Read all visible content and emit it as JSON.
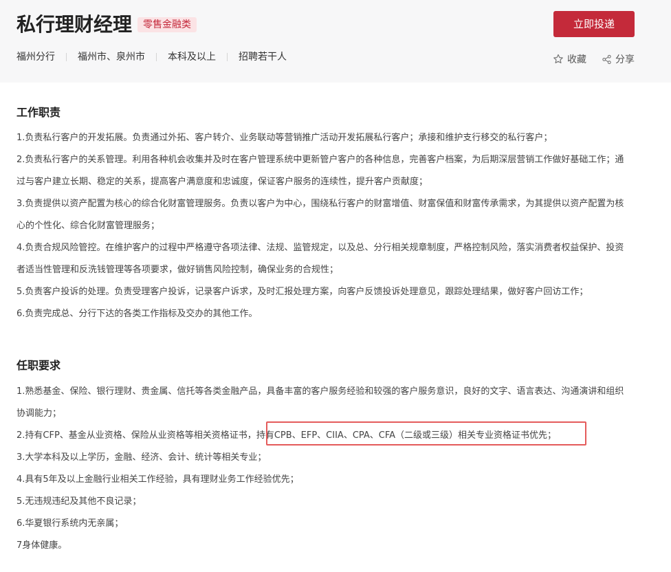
{
  "header": {
    "title": "私行理财经理",
    "category": "零售金融类",
    "meta": [
      "福州分行",
      "福州市、泉州市",
      "本科及以上",
      "招聘若干人"
    ],
    "apply_label": "立即投递",
    "favorite_label": "收藏",
    "share_label": "分享"
  },
  "colors": {
    "accent": "#c42a3a",
    "badge_bg": "#fbe3e5",
    "highlight": "#e45a5a"
  },
  "duties": {
    "title": "工作职责",
    "items": [
      "1.负责私行客户的开发拓展。负责通过外拓、客户转介、业务联动等营销推广活动开发拓展私行客户；承接和维护支行移交的私行客户；",
      "2.负责私行客户的关系管理。利用各种机会收集并及时在客户管理系统中更新管户客户的各种信息，完善客户档案，为后期深层营销工作做好基础工作；通过与客户建立长期、稳定的关系，提高客户满意度和忠诚度，保证客户服务的连续性，提升客户贡献度；",
      "3.负责提供以资产配置为核心的综合化财富管理服务。负责以客户为中心，围绕私行客户的财富增值、财富保值和财富传承需求，为其提供以资产配置为核心的个性化、综合化财富管理服务；",
      "4.负责合规风险管控。在维护客户的过程中严格遵守各项法律、法规、监管规定，以及总、分行相关规章制度，严格控制风险，落实消费者权益保护、投资者适当性管理和反洗钱管理等各项要求，做好销售风险控制，确保业务的合规性；",
      "5.负责客户投诉的处理。负责受理客户投诉，记录客户诉求，及时汇报处理方案，向客户反馈投诉处理意见，跟踪处理结果，做好客户回访工作；",
      "6.负责完成总、分行下达的各类工作指标及交办的其他工作。"
    ]
  },
  "requirements": {
    "title": "任职要求",
    "item1": "1.熟悉基金、保险、银行理财、贵金属、信托等各类金融产品，具备丰富的客户服务经验和较强的客户服务意识，良好的文字、语言表达、沟通演讲和组织协调能力；",
    "item2_prefix": "2.持有CFP、基金从业资格、保险从业资格等相关资格证书，",
    "item2_highlight": "持有CPB、EFP、CIIA、CPA、CFA（二级或三级）相关专业资格证书优先；",
    "item3": "3.大学本科及以上学历，金融、经济、会计、统计等相关专业；",
    "item4": "4.具有5年及以上金融行业相关工作经验，具有理财业务工作经验优先；",
    "item5": "5.无违规违纪及其他不良记录；",
    "item6": "6.华夏银行系统内无亲属；",
    "item7": "7身体健康。"
  }
}
